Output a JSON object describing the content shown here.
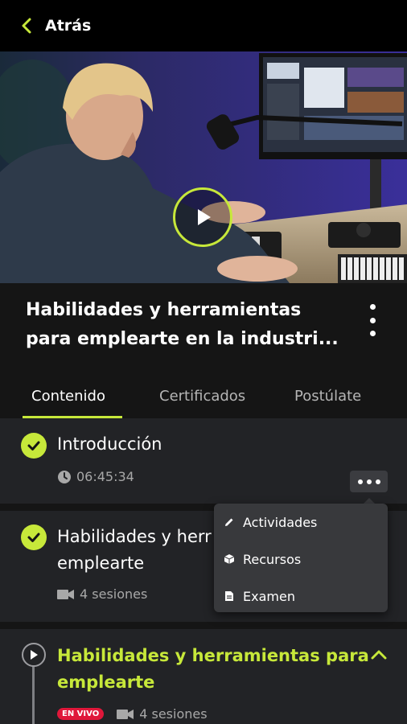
{
  "header": {
    "back_label": "Atrás"
  },
  "course": {
    "title": "Habilidades y herramientas para emplearte en la industri..."
  },
  "tabs": [
    {
      "label": "Contenido",
      "active": true
    },
    {
      "label": "Certificados",
      "active": false
    },
    {
      "label": "Postúlate",
      "active": false
    }
  ],
  "sections": [
    {
      "title": "Introducción",
      "duration": "06:45:34",
      "completed": true
    },
    {
      "title_line1": "Habilidades y herr",
      "title_line2": "emplearte",
      "sessions": "4 sesiones",
      "completed": true
    },
    {
      "title_line1": "Habilidades y herramientas para",
      "title_line2": "emplearte",
      "badge": "EN VIVO",
      "sessions": "4 sesiones",
      "current": true
    }
  ],
  "menu": {
    "items": [
      "Actividades",
      "Recursos",
      "Examen"
    ]
  },
  "colors": {
    "accent": "#c7e83a",
    "live": "#e0173a",
    "background": "#151515",
    "card": "#222326"
  }
}
